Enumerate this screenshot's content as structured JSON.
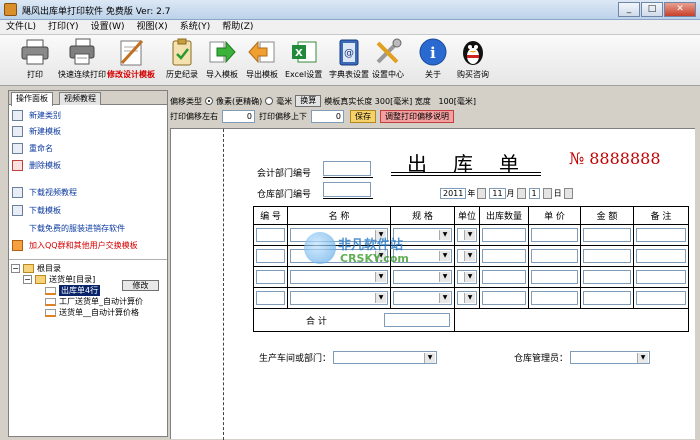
{
  "window": {
    "title": "飓风出库单打印软件 免费版  Ver: 2.7"
  },
  "menu": [
    "文件(L)",
    "打印(Y)",
    "设置(W)",
    "视图(X)",
    "系统(Y)",
    "帮助(Z)"
  ],
  "toolbar": [
    {
      "label": "打印",
      "icon": "printer-icon"
    },
    {
      "label": "快速连续打印",
      "icon": "batch-printer-icon"
    },
    {
      "label": "修改设计模板",
      "icon": "design-template-icon",
      "highlight": true
    },
    {
      "label": "历史纪录",
      "icon": "history-clipboard-icon"
    },
    {
      "label": "导入模板",
      "icon": "import-arrow-icon"
    },
    {
      "label": "导出模板",
      "icon": "export-arrow-icon"
    },
    {
      "label": "Excel设置",
      "icon": "excel-icon"
    },
    {
      "label": "字典表设置",
      "icon": "dictionary-icon"
    },
    {
      "label": "设置中心",
      "icon": "settings-tools-icon"
    },
    {
      "label": "关于",
      "icon": "info-icon"
    },
    {
      "label": "购买咨询",
      "icon": "qq-penguin-icon"
    }
  ],
  "panel": {
    "tabs": [
      "操作面板",
      "视频教程"
    ],
    "actions": [
      {
        "label": "新建类别",
        "icon": "new-category-icon"
      },
      {
        "label": "新建模板",
        "icon": "new-template-icon"
      },
      {
        "label": "重命名",
        "icon": "rename-icon"
      },
      {
        "label": "删除模板",
        "icon": "delete-icon"
      },
      {
        "label": "下载视频教程",
        "icon": "download-video-icon"
      },
      {
        "label": "下载模板",
        "icon": "download-template-icon"
      },
      {
        "label": "下载免费的服装进销存软件",
        "icon": ""
      },
      {
        "label": "加入QQ群和其他用户交换模板",
        "icon": "qq-group-icon",
        "red": true
      }
    ],
    "tree": {
      "root": "根目录",
      "folder": "送货单[目录]",
      "items": [
        "出库单4行",
        "工厂送货单_自动计算价",
        "送货单__自动计算价格"
      ],
      "edit_button": "修改"
    }
  },
  "options": {
    "offset_type_label": "偏移类型",
    "pixel_option": "像素(更精确)",
    "mm_option": "毫米",
    "convert_button": "换算",
    "template_width_label": "模板真实长度",
    "template_width": "300[毫米]",
    "height_label": "宽度",
    "height_value": "100[毫米]",
    "offset_lr_label": "打印偏移左右",
    "offset_lr": "0",
    "offset_ud_label": "打印偏移上下",
    "offset_ud": "0",
    "save_button": "保存",
    "help_button": "调整打印偏移说明"
  },
  "form": {
    "title": "出库单",
    "serial_prefix": "№",
    "serial": "8888888",
    "dept_code_label": "会计部门编号",
    "warehouse_code_label": "仓库部门编号",
    "date": {
      "year": "2011",
      "year_unit": "年",
      "month": "11",
      "month_unit": "月",
      "day": "1",
      "day_unit": "日"
    },
    "columns": [
      "编 号",
      "名     称",
      "规   格",
      "单位",
      "出库数量",
      "单 价",
      "金   额",
      "备   注"
    ],
    "rows": 4,
    "total_label": "合          计",
    "workshop_label": "生产车间或部门：",
    "keeper_label": "仓库管理员："
  },
  "watermark": {
    "line1": "非凡软件站",
    "line2": "CRSKY.com"
  }
}
